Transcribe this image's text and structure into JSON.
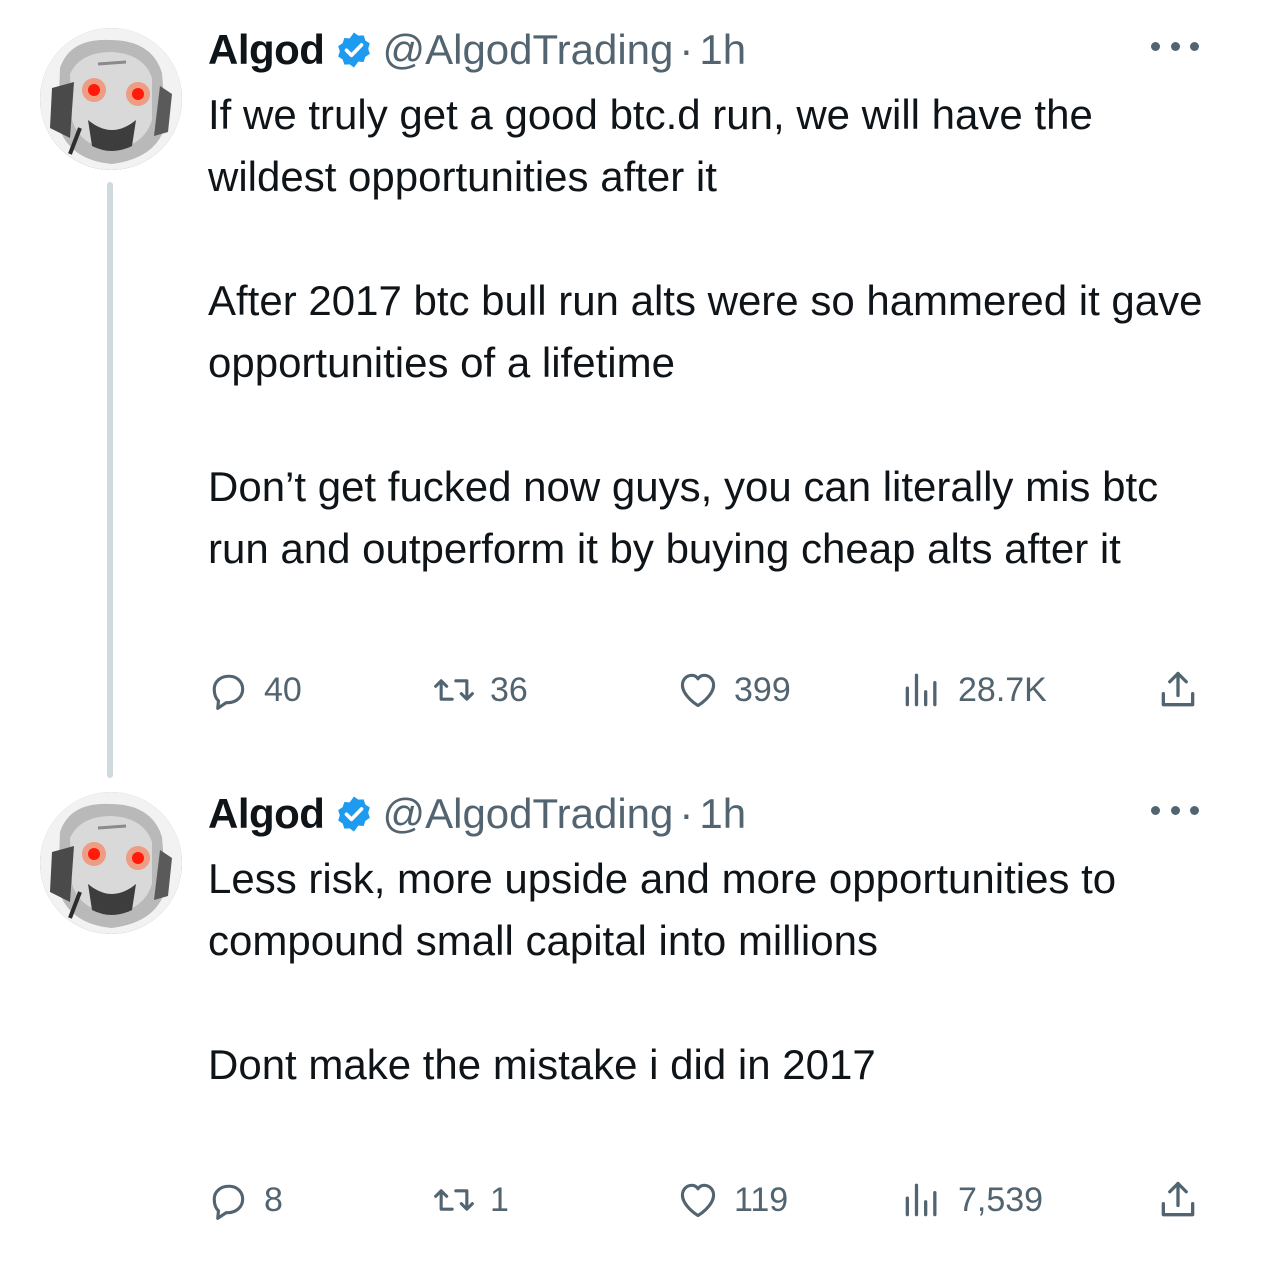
{
  "tweets": [
    {
      "display_name": "Algod",
      "handle": "@AlgodTrading",
      "separator": "·",
      "time": "1h",
      "paragraphs": [
        "If we truly get a good btc.d run, we will have the wildest opportunities after it",
        "After 2017 btc bull run alts were so hammered it gave opportunities of a lifetime",
        "Don’t get fucked now guys, you can literally mis btc run and outperform it by buying cheap alts after it"
      ],
      "stats": {
        "replies": "40",
        "retweets": "36",
        "likes": "399",
        "views": "28.7K"
      }
    },
    {
      "display_name": "Algod",
      "handle": "@AlgodTrading",
      "separator": "·",
      "time": "1h",
      "paragraphs": [
        "Less risk, more upside and more opportunities to compound small capital into millions",
        "Dont make the mistake i did in 2017"
      ],
      "stats": {
        "replies": "8",
        "retweets": "1",
        "likes": "119",
        "views": "7,539"
      }
    }
  ],
  "icons": {
    "verified": "verified-badge-icon",
    "more": "more-options-icon",
    "reply": "reply-icon",
    "retweet": "retweet-icon",
    "like": "heart-icon",
    "views": "views-chart-icon",
    "share": "share-icon"
  },
  "colors": {
    "text": "#0f1419",
    "secondary": "#536471",
    "verified": "#1d9bf0",
    "thread_line": "#cfd9de",
    "avatar_eye": "#ff2a1a"
  }
}
